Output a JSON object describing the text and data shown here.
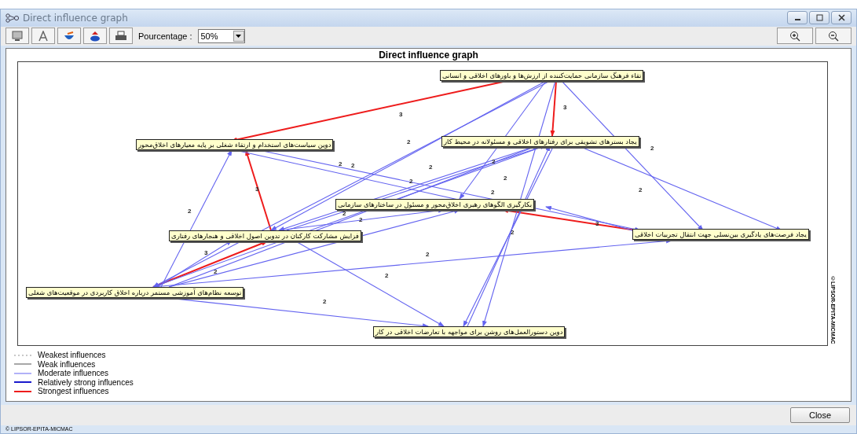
{
  "window": {
    "title": "Direct influence graph"
  },
  "toolbar": {
    "percentage_label": "Pourcentage :",
    "percentage_value": "50%"
  },
  "graph": {
    "title": "Direct influence graph",
    "copyright": "©LIPSOR-EPITA-MICMAC",
    "nodes": [
      {
        "label": "تقاء فرهنگ سازمانی حمایت‌کننده از ارزش‌ها و باورهای اخلاقی و انسانی"
      },
      {
        "label": "یجاد بسترهای تشویقی برای رفتارهای اخلاقی و مسئولانه در محیط کار"
      },
      {
        "label": "دوین سیاست‌های استخدام و ارتقاء شغلی بر پایه معیارهای اخلاق‌محور"
      },
      {
        "label": "بکارگیری الگوهای رهبری اخلاق‌محور و مسئول در ساختارهای سازمانی"
      },
      {
        "label": "یجاد فرصت‌های یادگیری بین‌نسلی جهت انتقال تجربیات اخلاقی"
      },
      {
        "label": "فزایش مشارکت کارکنان در تدوین اصول اخلاقی و هنجارهای رفتاری"
      },
      {
        "label": "توسعه نظام‌های آموزشی مستمر درباره اخلاق کاربردی در موقعیت‌های شغلی"
      },
      {
        "label": "دوین دستورالعمل‌های روشن برای مواجهه با تعارضات اخلاقی در کار"
      }
    ],
    "edges": [
      {
        "kind": "strongest",
        "label": "3"
      },
      {
        "kind": "strongest",
        "label": "3"
      },
      {
        "kind": "strongest",
        "label": "3"
      },
      {
        "kind": "strongest",
        "label": "3"
      },
      {
        "kind": "strongest",
        "label": "3"
      },
      {
        "kind": "moderate",
        "label": "2"
      },
      {
        "kind": "moderate",
        "label": "2"
      },
      {
        "kind": "moderate",
        "label": "2"
      },
      {
        "kind": "moderate",
        "label": "2"
      },
      {
        "kind": "moderate",
        "label": "2"
      },
      {
        "kind": "moderate",
        "label": "2"
      },
      {
        "kind": "moderate"
      },
      {
        "kind": "moderate"
      },
      {
        "kind": "moderate",
        "label": "2"
      },
      {
        "kind": "moderate",
        "label": "2"
      },
      {
        "kind": "moderate",
        "label": "2"
      },
      {
        "kind": "moderate",
        "label": "2"
      },
      {
        "kind": "moderate",
        "label": "2"
      },
      {
        "kind": "moderate"
      },
      {
        "kind": "moderate",
        "label": "2"
      },
      {
        "kind": "moderate",
        "label": "2"
      },
      {
        "kind": "moderate",
        "label": "2"
      },
      {
        "kind": "moderate",
        "label": "2"
      },
      {
        "kind": "moderate",
        "label": "2"
      },
      {
        "kind": "moderate",
        "label": "2"
      },
      {
        "kind": "moderate",
        "label": "2"
      },
      {
        "kind": "moderate"
      }
    ]
  },
  "legend": [
    {
      "kind": "weakest",
      "label": "Weakest influences"
    },
    {
      "kind": "weak",
      "label": "Weak influences"
    },
    {
      "kind": "moderate",
      "label": "Moderate influences"
    },
    {
      "kind": "relatively_strong",
      "label": "Relatively strong influences"
    },
    {
      "kind": "strongest",
      "label": "Strongest influences"
    }
  ],
  "buttons": {
    "close": "Close"
  },
  "status_bar": "© LIPSOR-EPITA-MICMAC"
}
